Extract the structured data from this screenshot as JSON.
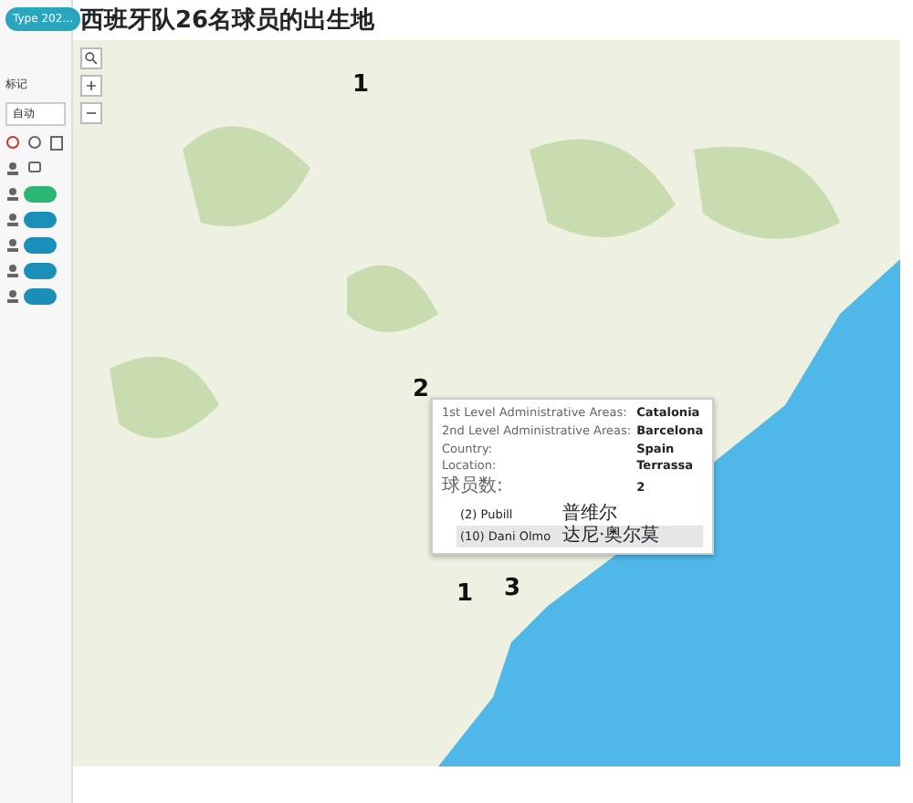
{
  "title": "西班牙队26名球员的出生地",
  "filter_badge": "Type 202...",
  "marks_card": {
    "label": "标记",
    "mark_type": "自动",
    "pills": [
      {
        "color": "#2bb673"
      },
      {
        "color": "#1a8fb8"
      },
      {
        "color": "#1a8fb8"
      },
      {
        "color": "#1a8fb8"
      },
      {
        "color": "#1a8fb8"
      }
    ]
  },
  "map": {
    "markers": [
      {
        "count": "1"
      },
      {
        "count": "2"
      },
      {
        "count": "1"
      },
      {
        "count": "3"
      }
    ]
  },
  "tooltip": {
    "fields": [
      {
        "label": "1st Level Administrative Areas:",
        "value": "Catalonia"
      },
      {
        "label": "2nd Level Administrative Areas:",
        "value": "Barcelona"
      },
      {
        "label": "Country:",
        "value": "Spain"
      },
      {
        "label": "Location:",
        "value": "Terrassa"
      },
      {
        "label": "球员数:",
        "value": "2"
      }
    ],
    "players": [
      {
        "name": "(2) Pubill",
        "name_zh": "普维尔",
        "selected": false
      },
      {
        "name": "(10) Dani Olmo",
        "name_zh": "达尼·奥尔莫",
        "selected": true
      }
    ]
  }
}
